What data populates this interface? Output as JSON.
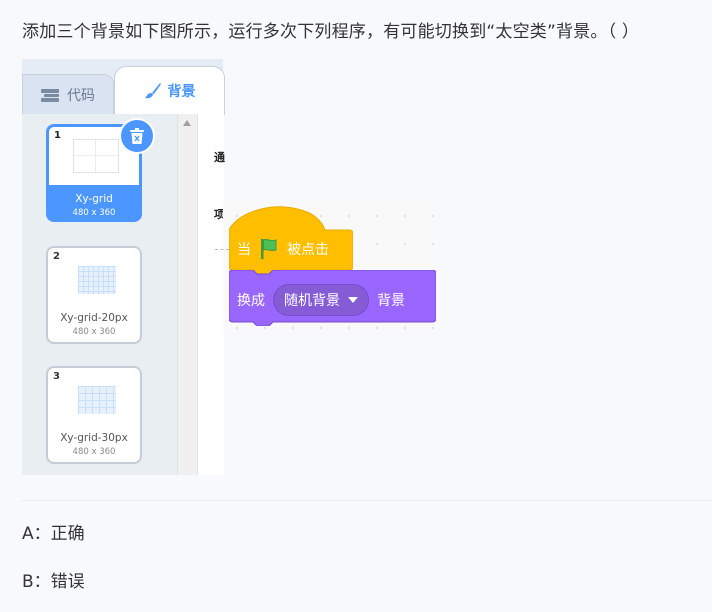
{
  "question": "添加三个背景如下图所示，运行多次下列程序，有可能切换到“太空类”背景。（  ）",
  "tabs": {
    "code": "代码",
    "backdrops": "背景"
  },
  "backdrops": [
    {
      "number": "1",
      "name": "Xy-grid",
      "size": "480 x 360"
    },
    {
      "number": "2",
      "name": "Xy-grid-20px",
      "size": "480 x 360"
    },
    {
      "number": "3",
      "name": "Xy-grid-30px",
      "size": "480 x 360"
    }
  ],
  "edge_chars": [
    "通",
    "项"
  ],
  "blocks": {
    "hat": {
      "before": "当",
      "after": "被点击"
    },
    "switch": {
      "before": "换成",
      "dropdown": "随机背景",
      "after": "背景"
    }
  },
  "options": [
    "A：正确",
    "B：错误"
  ],
  "colors": {
    "accent": "#4c97ff",
    "events": "#ffbf00",
    "looks": "#9966ff",
    "flag": "#4cbf56"
  },
  "icons": {
    "code_tab": "blocks-icon",
    "backdrop_tab": "paintbrush-icon",
    "delete": "trash-icon",
    "flag": "green-flag-icon",
    "dropdown": "caret-down-icon"
  }
}
